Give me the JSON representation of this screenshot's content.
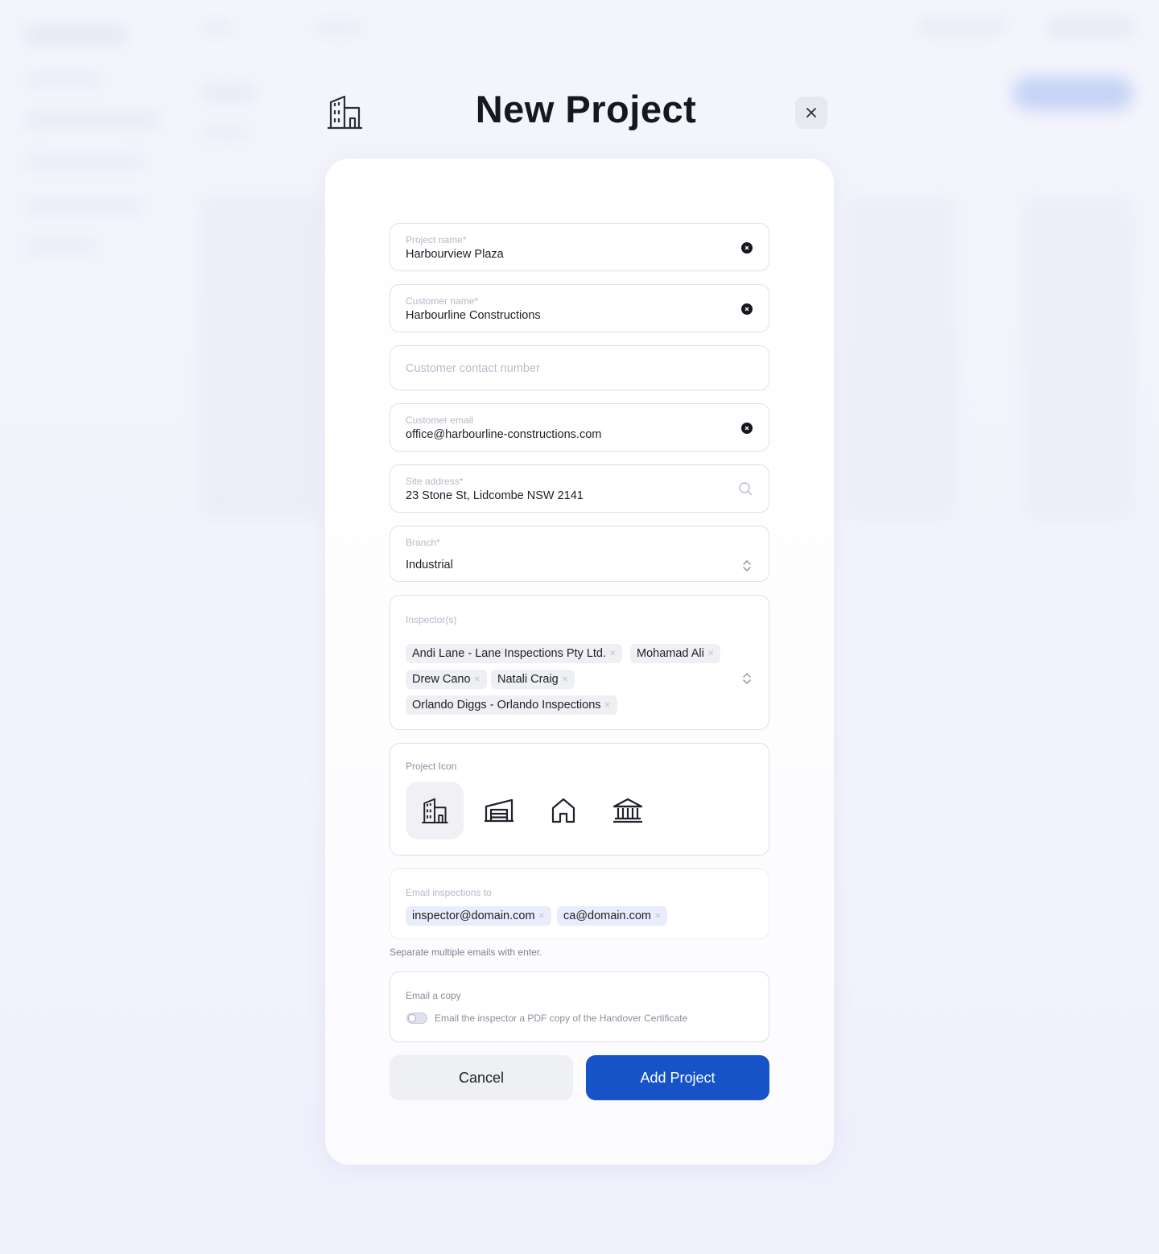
{
  "modal": {
    "title": "New Project"
  },
  "fields": {
    "project_name": {
      "label": "Project name*",
      "value": "Harbourview Plaza"
    },
    "customer_name": {
      "label": "Customer name*",
      "value": "Harbourline Constructions"
    },
    "customer_contact": {
      "placeholder": "Customer contact number"
    },
    "customer_email": {
      "label": "Customer email",
      "value": "office@harbourline-constructions.com"
    },
    "site_address": {
      "label": "Site address*",
      "value": "23 Stone St, Lidcombe NSW 2141"
    },
    "branch": {
      "label": "Branch*",
      "value": "Industrial"
    },
    "inspectors": {
      "label": "Inspector(s)",
      "chips": [
        "Andi Lane - Lane Inspections Pty Ltd.",
        "Mohamad Ali",
        "Drew Cano",
        "Natali Craig",
        "Orlando Diggs - Orlando Inspections"
      ]
    },
    "project_icon": {
      "label": "Project Icon",
      "options": [
        "office-building-icon",
        "warehouse-icon",
        "house-icon",
        "bank-icon"
      ],
      "selected": "office-building-icon"
    },
    "email_inspections": {
      "label": "Email inspections to",
      "chips": [
        "inspector@domain.com",
        "ca@domain.com"
      ],
      "helper": "Separate multiple emails with enter."
    },
    "email_copy": {
      "label": "Email a copy",
      "toggle_label": "Email the inspector a PDF copy of the Handover Certificate",
      "enabled": false
    }
  },
  "actions": {
    "cancel_label": "Cancel",
    "submit_label": "Add Project"
  },
  "colors": {
    "primary": "#1652c8",
    "card_bg": "#ffffff",
    "page_bg": "#eef0fb"
  }
}
